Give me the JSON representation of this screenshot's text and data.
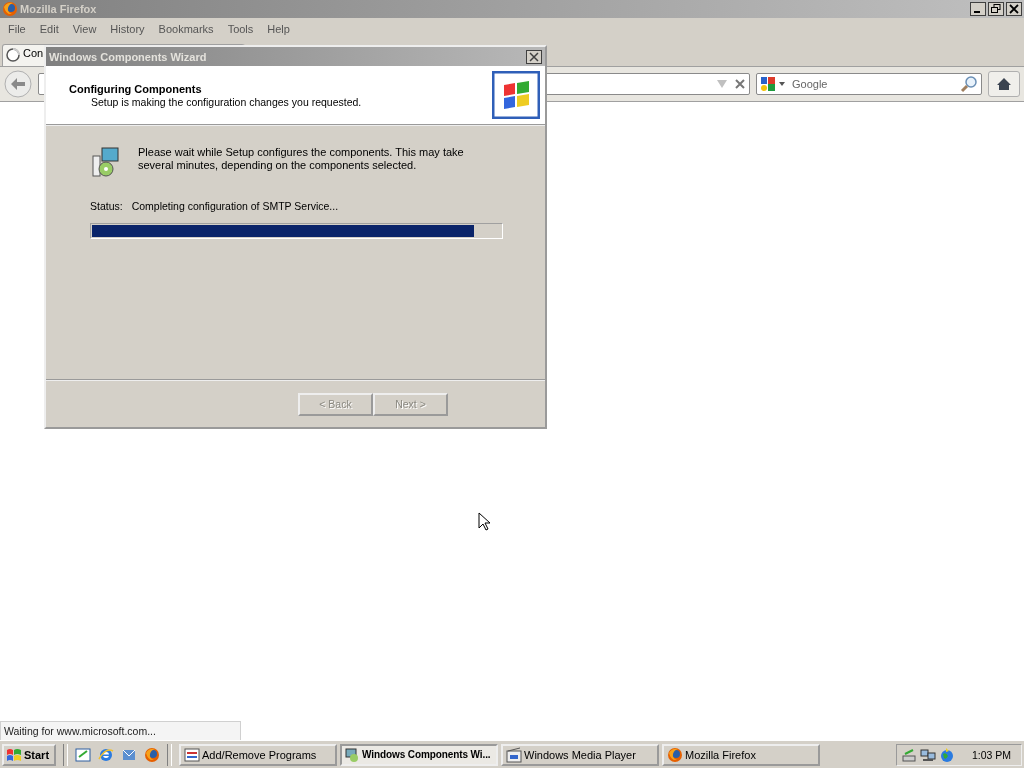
{
  "browser": {
    "title": "Mozilla Firefox",
    "menu": [
      "File",
      "Edit",
      "View",
      "History",
      "Bookmarks",
      "Tools",
      "Help"
    ],
    "tab": {
      "title": "Con",
      "loading": true
    },
    "search": {
      "placeholder": "Google"
    },
    "status": "Waiting for www.microsoft.com..."
  },
  "wizard": {
    "title": "Windows Components Wizard",
    "heading": "Configuring Components",
    "subheading": "Setup is making the configuration changes you requested.",
    "message": "Please wait while Setup configures the components. This may take several minutes, depending on the components selected.",
    "status_label": "Status:",
    "status_text": "Completing configuration of SMTP Service...",
    "progress": {
      "level": 0.935
    },
    "buttons": [
      {
        "label": "< Back",
        "disabled": true
      },
      {
        "label": "Next >",
        "disabled": true
      }
    ]
  },
  "taskbar": {
    "start": "Start",
    "tasks": [
      {
        "label": "Add/Remove Programs",
        "kind": "programs",
        "selected": false
      },
      {
        "label": "Windows Components Wi...",
        "kind": "wizard",
        "selected": true
      },
      {
        "label": "Windows Media Player",
        "kind": "media",
        "selected": false
      },
      {
        "label": "Mozilla Firefox",
        "kind": "firefox",
        "selected": false
      }
    ],
    "clock": "1:03 PM"
  }
}
